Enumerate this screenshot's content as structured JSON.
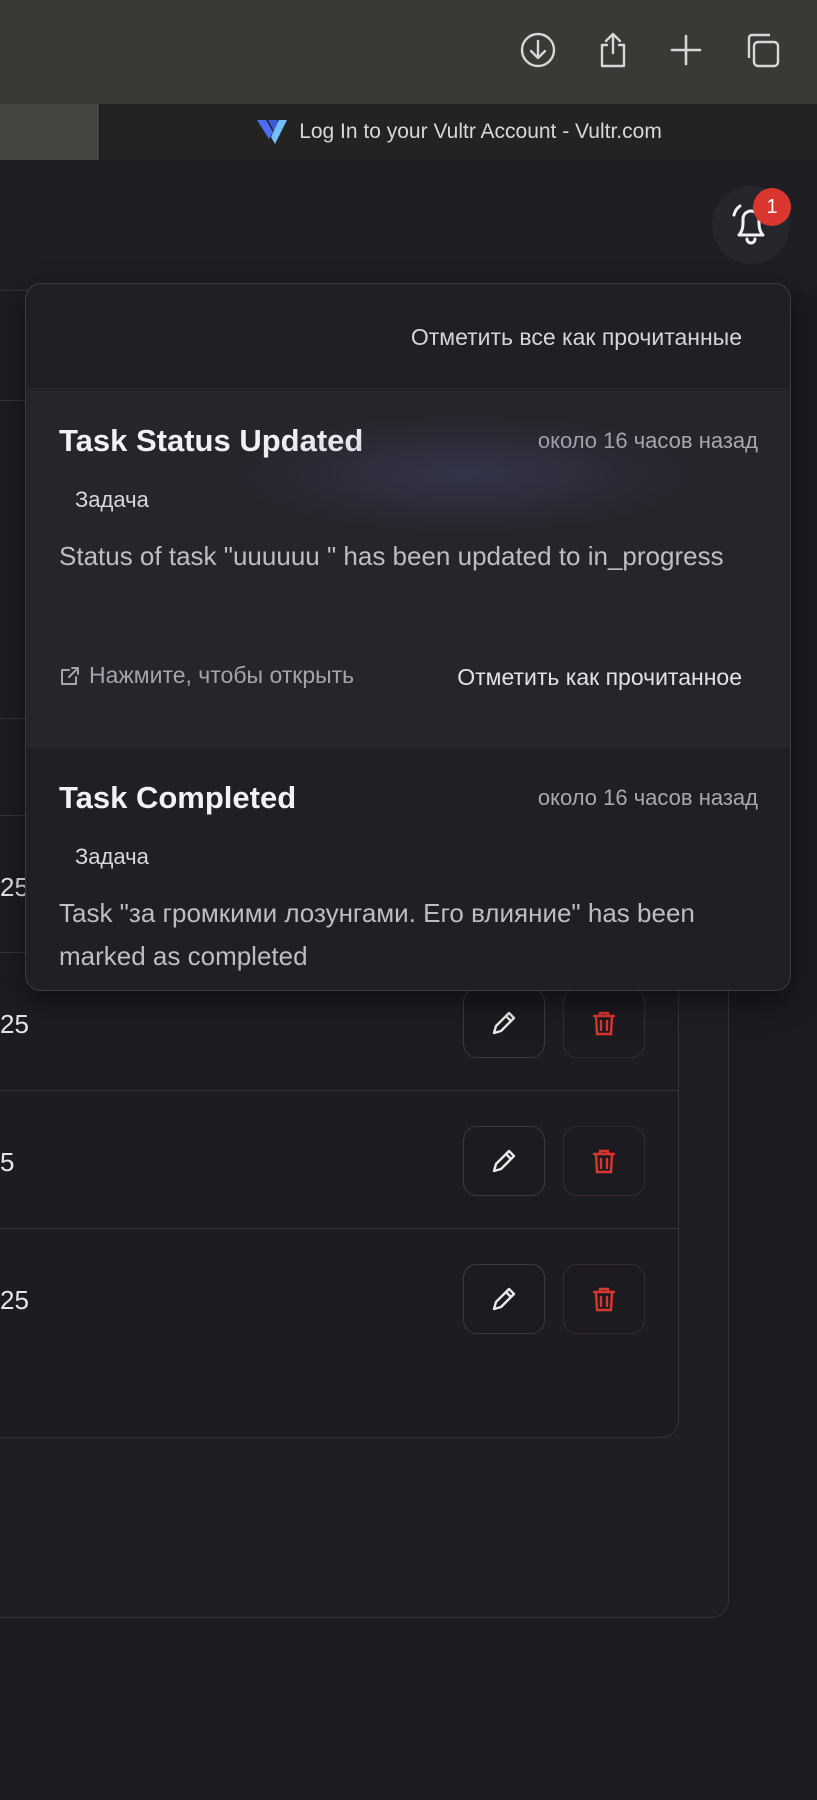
{
  "browser": {
    "tab_title": "Log In to your Vultr Account - Vultr.com",
    "toolbar_icons": [
      "download-icon",
      "share-icon",
      "plus-icon",
      "tabs-icon"
    ]
  },
  "header": {
    "bell_icon": "bell-icon",
    "notification_count": "1"
  },
  "background_rows": [
    {
      "text": "25"
    },
    {
      "text": "25"
    },
    {
      "text": "5"
    },
    {
      "text": "25"
    }
  ],
  "notifications": {
    "mark_all_label": "Отметить все как прочитанные",
    "items": [
      {
        "title": "Task Status Updated",
        "time": "около 16 часов назад",
        "type": "Задача",
        "message": "Status of task \"uuuuuu \" has been updated to in_progress",
        "open_hint": "Нажмите, чтобы открыть",
        "mark_read_label": "Отметить как прочитанное"
      },
      {
        "title": "Task Completed",
        "time": "около 16 часов назад",
        "type": "Задача",
        "message": "Task \"за громкими лозунгами. Его влияние\" has been marked as completed"
      }
    ]
  },
  "colors": {
    "badge": "#d9362f",
    "delete_icon": "#d9362f",
    "background": "#1b1b20"
  }
}
